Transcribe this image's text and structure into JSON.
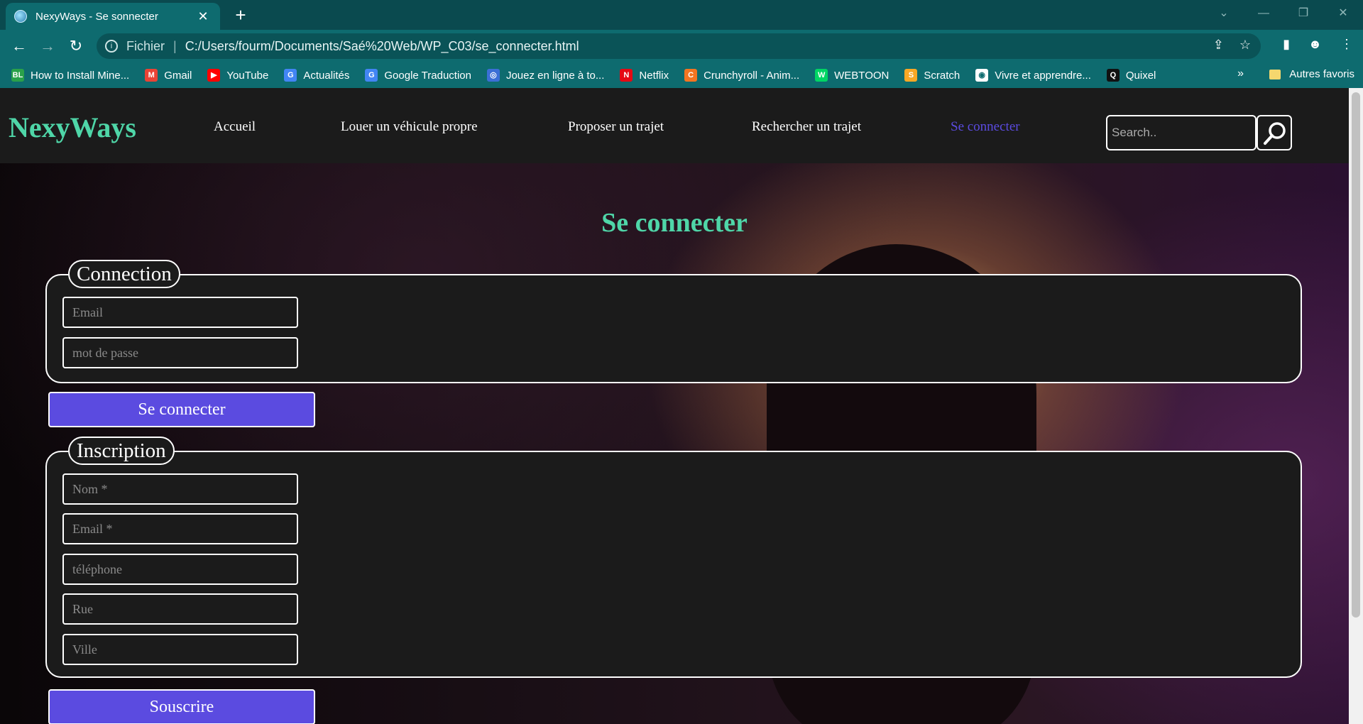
{
  "browser": {
    "tab_title": "NexyWays - Se sonnecter",
    "address_scheme": "Fichier",
    "address_url": "C:/Users/fourm/Documents/Saé%20Web/WP_C03/se_connecter.html",
    "bookmarks": [
      {
        "label": "How to Install Mine...",
        "icon": "bl-icon",
        "color": "#2aa14a",
        "glyph": "BL"
      },
      {
        "label": "Gmail",
        "icon": "gmail-icon",
        "color": "#ea4335",
        "glyph": "M"
      },
      {
        "label": "YouTube",
        "icon": "youtube-icon",
        "color": "#ff0000",
        "glyph": "▶"
      },
      {
        "label": "Actualités",
        "icon": "news-icon",
        "color": "#4285f4",
        "glyph": "G"
      },
      {
        "label": "Google Traduction",
        "icon": "translate-icon",
        "color": "#4285f4",
        "glyph": "G"
      },
      {
        "label": "Jouez en ligne à to...",
        "icon": "game-icon",
        "color": "#3b6fd6",
        "glyph": "◎"
      },
      {
        "label": "Netflix",
        "icon": "netflix-icon",
        "color": "#e50914",
        "glyph": "N"
      },
      {
        "label": "Crunchyroll - Anim...",
        "icon": "crunchyroll-icon",
        "color": "#f47521",
        "glyph": "C"
      },
      {
        "label": "WEBTOON",
        "icon": "webtoon-icon",
        "color": "#00d564",
        "glyph": "W"
      },
      {
        "label": "Scratch",
        "icon": "scratch-icon",
        "color": "#f9a825",
        "glyph": "S"
      },
      {
        "label": "Vivre et apprendre...",
        "icon": "globe-icon",
        "color": "#ffffff",
        "glyph": "◉"
      },
      {
        "label": "Quixel",
        "icon": "quixel-icon",
        "color": "#111111",
        "glyph": "Q"
      }
    ],
    "more_label": "»",
    "other_bookmarks": "Autres favoris"
  },
  "site": {
    "logo": "NexyWays",
    "nav": [
      "Accueil",
      "Louer un véhicule propre",
      "Proposer un trajet",
      "Rechercher un trajet",
      "Se connecter"
    ],
    "search_placeholder": "Search..",
    "page_title": "Se connecter",
    "login": {
      "legend": "Connection",
      "fields": [
        "Email",
        "mot de passe"
      ],
      "button": "Se connecter"
    },
    "signup": {
      "legend": "Inscription",
      "fields": [
        "Nom *",
        "Email *",
        "téléphone",
        "Rue",
        "Ville"
      ],
      "button": "Souscrire"
    }
  },
  "colors": {
    "accent_green": "#4fd6a8",
    "accent_purple": "#5b4be0",
    "chrome_teal": "#0e6b6f"
  }
}
